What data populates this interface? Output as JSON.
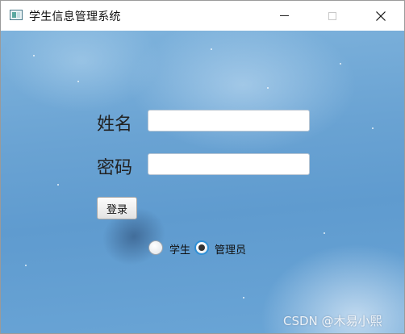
{
  "window": {
    "title": "学生信息管理系统",
    "icons": {
      "app": "app-window-icon",
      "minimize": "minimize-icon",
      "maximize": "maximize-icon",
      "close": "close-icon"
    },
    "close_glyph": "✕"
  },
  "form": {
    "name_label": "姓名",
    "password_label": "密码",
    "name_value": "",
    "password_value": "",
    "login_button": "登录",
    "role_options": [
      {
        "label": "学生",
        "selected": false
      },
      {
        "label": "管理员",
        "selected": true
      }
    ]
  },
  "watermark": "CSDN @木易小熙",
  "colors": {
    "accent": "#2e8fd6",
    "background": "#6aa3d3"
  }
}
